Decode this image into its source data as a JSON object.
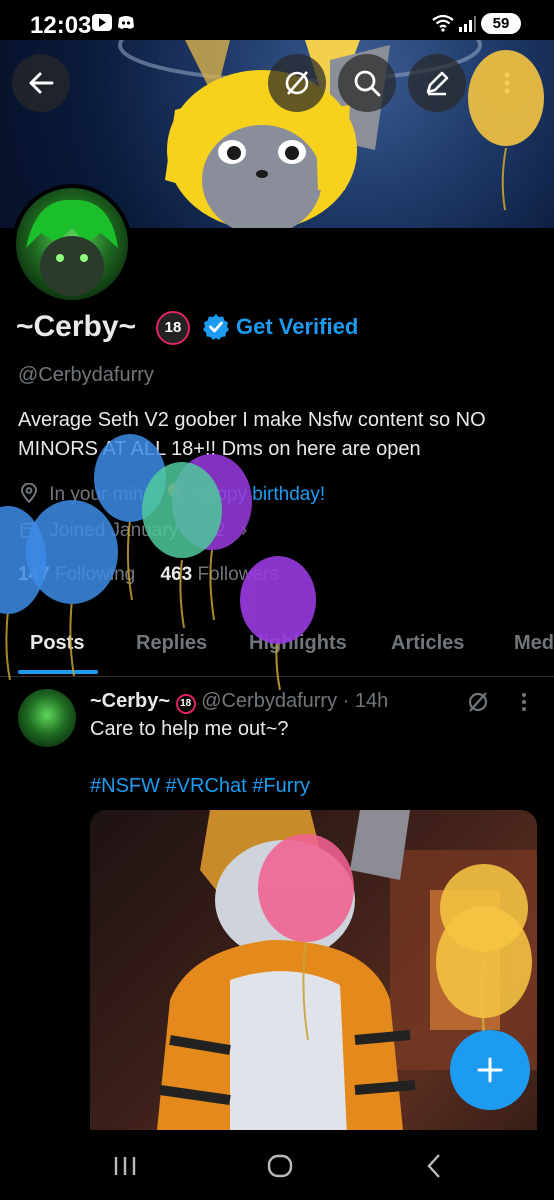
{
  "status_bar": {
    "time": "12:03",
    "battery": "59",
    "icons": [
      "youtube-icon",
      "discord-icon",
      "wifi-icon",
      "signal-icon",
      "battery-icon"
    ]
  },
  "banner": {
    "actions": [
      "back-arrow-icon",
      "grok-slash-icon",
      "search-icon",
      "compose-icon",
      "more-vertical-icon"
    ]
  },
  "profile": {
    "display_name": "~Cerby~",
    "age_badge": "18",
    "get_verified_label": "Get Verified",
    "handle": "@Cerbydafurry",
    "bio": "Average Seth V2 goober  I make Nsfw content so  NO MINORS AT ALL  18+!! Dms on here are open",
    "location_text": "In your mind",
    "birthday_text": "Happy birthday!",
    "joined": "Joined January 2022",
    "following_count": "147",
    "following_label": "Following",
    "followers_count": "463",
    "followers_label": "Followers"
  },
  "tabs": [
    {
      "label": "Posts",
      "active": true
    },
    {
      "label": "Replies"
    },
    {
      "label": "Highlights"
    },
    {
      "label": "Articles"
    },
    {
      "label": "Media"
    }
  ],
  "post": {
    "name": "~Cerby~",
    "badge": "18",
    "handle_time": "@Cerbydafurry · 14h",
    "text": "Care to help me out~?",
    "hashtags": "#NSFW #VRChat #Furry"
  },
  "colors": {
    "accent": "#1d9bf0",
    "background": "#000000",
    "text_primary": "#e7e9ea",
    "text_secondary": "#71767b"
  }
}
